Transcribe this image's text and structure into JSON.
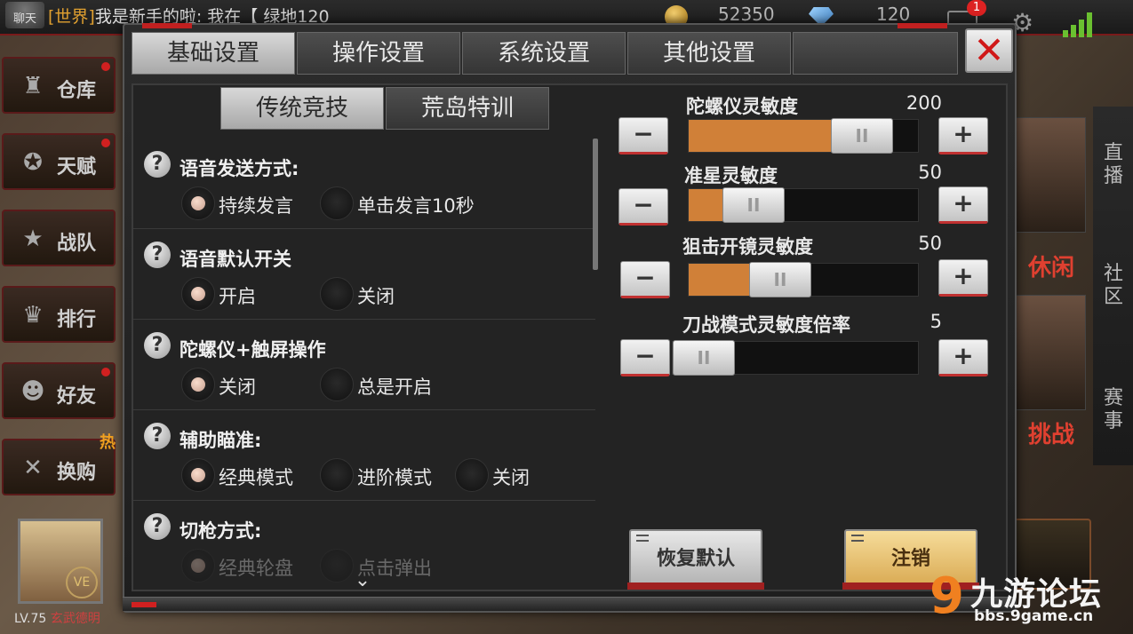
{
  "top_bar": {
    "chat_icon_label": "聊天",
    "chat_channel": "[世界]",
    "chat_message": "我是新手的啦: 我在",
    "chat_link": "【 绿地120",
    "coins": "52350",
    "gems": "120",
    "mail_badge": "1",
    "icons": [
      "coin-icon",
      "gem-icon",
      "mail-icon",
      "gear-icon",
      "signal-icon"
    ]
  },
  "side_nav": {
    "items": [
      {
        "label": "仓库",
        "icon": "warehouse-icon"
      },
      {
        "label": "天赋",
        "icon": "talent-icon"
      },
      {
        "label": "战队",
        "icon": "team-icon"
      },
      {
        "label": "排行",
        "icon": "trophy-icon"
      },
      {
        "label": "好友",
        "icon": "friends-icon"
      },
      {
        "label": "换购",
        "icon": "tools-icon"
      }
    ],
    "hot_tag": "热"
  },
  "player": {
    "vip_label": "VE",
    "level": "LV.75",
    "name": "玄武德明"
  },
  "right_panel": {
    "tabs": [
      "直播",
      "社区",
      "赛事"
    ],
    "promo_labels": [
      "休闲",
      "挑战"
    ]
  },
  "watermark": {
    "logo": "9",
    "name": "九游论坛",
    "url": "bbs.9game.cn"
  },
  "dialog": {
    "tabs": [
      "基础设置",
      "操作设置",
      "系统设置",
      "其他设置"
    ],
    "active_tab": 0,
    "close_label": "✕",
    "subtabs": [
      "传统竞技",
      "荒岛特训"
    ],
    "active_subtab": 0,
    "options": [
      {
        "title": "语音发送方式:",
        "choices": [
          "持续发言",
          "单击发言10秒"
        ],
        "selected": 0
      },
      {
        "title": "语音默认开关",
        "choices": [
          "开启",
          "关闭"
        ],
        "selected": 0
      },
      {
        "title": "陀螺仪+触屏操作",
        "choices": [
          "关闭",
          "总是开启"
        ],
        "selected": 0
      },
      {
        "title": "辅助瞄准:",
        "choices": [
          "经典模式",
          "进阶模式",
          "关闭"
        ],
        "selected": 0
      },
      {
        "title": "切枪方式:",
        "choices": [
          "经典轮盘",
          "点击弹出"
        ],
        "selected": 0
      }
    ],
    "help_symbol": "?",
    "sliders": [
      {
        "title": "陀螺仪灵敏度",
        "value": "200",
        "level": 0.85
      },
      {
        "title": "准星灵敏度",
        "value": "50",
        "level": 0.2
      },
      {
        "title": "狙击开镜灵敏度",
        "value": "50",
        "level": 0.36
      },
      {
        "title": "刀战模式灵敏度倍率",
        "value": "5",
        "level": 0.0
      }
    ],
    "minus_label": "−",
    "plus_label": "+",
    "knob_label": "II",
    "buttons": {
      "restore": "恢复默认",
      "logout": "注销"
    },
    "accent_color": "#d08038"
  }
}
